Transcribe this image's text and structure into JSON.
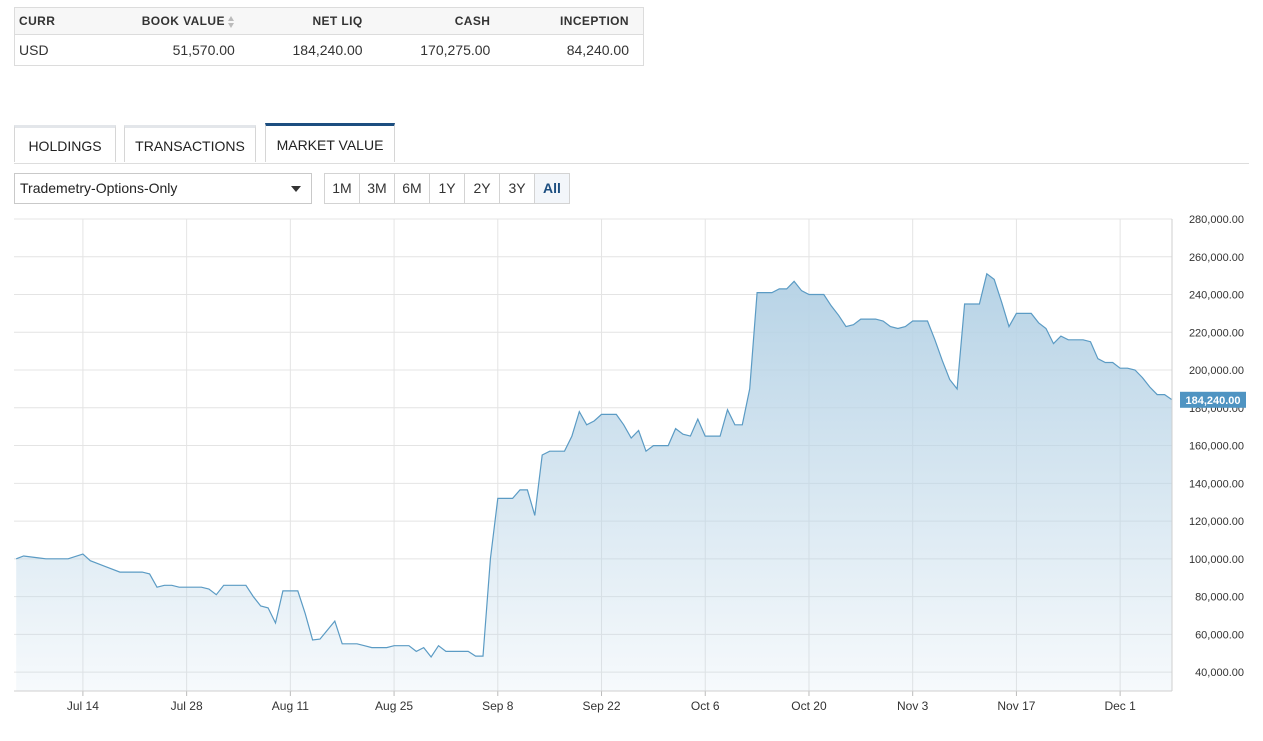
{
  "summary": {
    "headers": {
      "curr": "CURR",
      "book_value": "BOOK VALUE",
      "net_liq": "NET LIQ",
      "cash": "CASH",
      "inception": "INCEPTION"
    },
    "row": {
      "curr": "USD",
      "book_value": "51,570.00",
      "net_liq": "184,240.00",
      "cash": "170,275.00",
      "inception": "84,240.00"
    },
    "inception_color": "#2e7d32"
  },
  "tabs": [
    {
      "label": "HOLDINGS",
      "active": false
    },
    {
      "label": "TRANSACTIONS",
      "active": false
    },
    {
      "label": "MARKET VALUE",
      "active": true
    }
  ],
  "account_select": {
    "value": "Trademetry-Options-Only",
    "icon": "chevron-down-icon"
  },
  "ranges": [
    {
      "label": "1M",
      "active": false
    },
    {
      "label": "3M",
      "active": false
    },
    {
      "label": "6M",
      "active": false
    },
    {
      "label": "1Y",
      "active": false
    },
    {
      "label": "2Y",
      "active": false
    },
    {
      "label": "3Y",
      "active": false
    },
    {
      "label": "All",
      "active": true
    }
  ],
  "accent_color": "#1c4e80",
  "chart_data": {
    "type": "area",
    "title": "",
    "xlabel": "",
    "ylabel": "",
    "ylim": [
      30000,
      280000
    ],
    "y_axis_position": "right",
    "yticks": [
      "40,000.00",
      "60,000.00",
      "80,000.00",
      "100,000.00",
      "120,000.00",
      "140,000.00",
      "160,000.00",
      "180,000.00",
      "200,000.00",
      "220,000.00",
      "240,000.00",
      "260,000.00",
      "280,000.00"
    ],
    "xticks": [
      "Jul 14",
      "Jul 28",
      "Aug 11",
      "Aug 25",
      "Sep 8",
      "Sep 22",
      "Oct 6",
      "Oct 20",
      "Nov 3",
      "Nov 17",
      "Dec 1"
    ],
    "x_start": "Jul 5",
    "x_end": "Dec 4",
    "grid": true,
    "last_value_label": "184,240.00",
    "line_color": "#5b9bc4",
    "fill_color": "#b7d3e6",
    "series": [
      {
        "points": [
          [
            "Jul 5",
            100000
          ],
          [
            "Jul 6",
            101500
          ],
          [
            "Jul 8",
            100500
          ],
          [
            "Jul 9",
            100000
          ],
          [
            "Jul 11",
            100000
          ],
          [
            "Jul 12",
            100000
          ],
          [
            "Jul 14",
            102500
          ],
          [
            "Jul 15",
            99000
          ],
          [
            "Jul 16",
            97500
          ],
          [
            "Jul 17",
            96000
          ],
          [
            "Jul 19",
            93000
          ],
          [
            "Jul 21",
            93000
          ],
          [
            "Jul 22",
            93000
          ],
          [
            "Jul 23",
            92000
          ],
          [
            "Jul 24",
            85000
          ],
          [
            "Jul 25",
            86000
          ],
          [
            "Jul 26",
            86000
          ],
          [
            "Jul 27",
            85000
          ],
          [
            "Jul 28",
            85000
          ],
          [
            "Jul 30",
            85000
          ],
          [
            "Jul 31",
            84000
          ],
          [
            "Aug 1",
            81000
          ],
          [
            "Aug 2",
            86000
          ],
          [
            "Aug 4",
            86000
          ],
          [
            "Aug 5",
            86000
          ],
          [
            "Aug 6",
            80000
          ],
          [
            "Aug 7",
            75000
          ],
          [
            "Aug 8",
            74000
          ],
          [
            "Aug 9",
            66000
          ],
          [
            "Aug 10",
            83000
          ],
          [
            "Aug 12",
            83000
          ],
          [
            "Aug 13",
            71000
          ],
          [
            "Aug 14",
            57000
          ],
          [
            "Aug 15",
            57500
          ],
          [
            "Aug 17",
            67000
          ],
          [
            "Aug 18",
            55000
          ],
          [
            "Aug 20",
            55000
          ],
          [
            "Aug 21",
            54000
          ],
          [
            "Aug 22",
            53000
          ],
          [
            "Aug 24",
            53000
          ],
          [
            "Aug 25",
            54000
          ],
          [
            "Aug 26",
            54000
          ],
          [
            "Aug 27",
            54000
          ],
          [
            "Aug 28",
            51000
          ],
          [
            "Aug 29",
            53000
          ],
          [
            "Aug 30",
            48000
          ],
          [
            "Aug 31",
            54000
          ],
          [
            "Sep 1",
            51000
          ],
          [
            "Sep 3",
            51000
          ],
          [
            "Sep 4",
            51000
          ],
          [
            "Sep 5",
            48500
          ],
          [
            "Sep 6",
            48500
          ],
          [
            "Sep 7",
            100000
          ],
          [
            "Sep 8",
            132000
          ],
          [
            "Sep 9",
            132000
          ],
          [
            "Sep 10",
            132000
          ],
          [
            "Sep 11",
            136500
          ],
          [
            "Sep 12",
            136500
          ],
          [
            "Sep 13",
            123000
          ],
          [
            "Sep 14",
            155000
          ],
          [
            "Sep 15",
            157000
          ],
          [
            "Sep 16",
            157000
          ],
          [
            "Sep 17",
            157000
          ],
          [
            "Sep 18",
            165000
          ],
          [
            "Sep 19",
            178000
          ],
          [
            "Sep 20",
            171000
          ],
          [
            "Sep 21",
            173000
          ],
          [
            "Sep 22",
            176500
          ],
          [
            "Sep 23",
            176500
          ],
          [
            "Sep 24",
            176500
          ],
          [
            "Sep 25",
            171000
          ],
          [
            "Sep 26",
            164000
          ],
          [
            "Sep 27",
            168000
          ],
          [
            "Sep 28",
            157000
          ],
          [
            "Sep 29",
            160000
          ],
          [
            "Sep 30",
            160000
          ],
          [
            "Oct 1",
            160000
          ],
          [
            "Oct 2",
            169000
          ],
          [
            "Oct 3",
            166000
          ],
          [
            "Oct 4",
            165000
          ],
          [
            "Oct 5",
            174000
          ],
          [
            "Oct 6",
            165000
          ],
          [
            "Oct 7",
            165000
          ],
          [
            "Oct 8",
            165000
          ],
          [
            "Oct 9",
            179000
          ],
          [
            "Oct 10",
            171000
          ],
          [
            "Oct 11",
            171000
          ],
          [
            "Oct 12",
            190000
          ],
          [
            "Oct 13",
            241000
          ],
          [
            "Oct 14",
            241000
          ],
          [
            "Oct 15",
            241000
          ],
          [
            "Oct 16",
            243000
          ],
          [
            "Oct 17",
            243000
          ],
          [
            "Oct 18",
            247000
          ],
          [
            "Oct 19",
            242000
          ],
          [
            "Oct 20",
            240000
          ],
          [
            "Oct 21",
            240000
          ],
          [
            "Oct 22",
            240000
          ],
          [
            "Oct 23",
            234000
          ],
          [
            "Oct 24",
            229000
          ],
          [
            "Oct 25",
            223000
          ],
          [
            "Oct 26",
            224000
          ],
          [
            "Oct 27",
            227000
          ],
          [
            "Oct 28",
            227000
          ],
          [
            "Oct 29",
            227000
          ],
          [
            "Oct 30",
            226000
          ],
          [
            "Oct 31",
            223000
          ],
          [
            "Nov 1",
            222000
          ],
          [
            "Nov 2",
            223000
          ],
          [
            "Nov 3",
            226000
          ],
          [
            "Nov 4",
            226000
          ],
          [
            "Nov 5",
            226000
          ],
          [
            "Nov 6",
            216000
          ],
          [
            "Nov 7",
            205000
          ],
          [
            "Nov 8",
            195000
          ],
          [
            "Nov 9",
            190000
          ],
          [
            "Nov 10",
            235000
          ],
          [
            "Nov 11",
            235000
          ],
          [
            "Nov 12",
            235000
          ],
          [
            "Nov 13",
            251000
          ],
          [
            "Nov 14",
            248000
          ],
          [
            "Nov 15",
            236000
          ],
          [
            "Nov 16",
            223000
          ],
          [
            "Nov 17",
            230000
          ],
          [
            "Nov 18",
            230000
          ],
          [
            "Nov 19",
            230000
          ],
          [
            "Nov 20",
            225000
          ],
          [
            "Nov 21",
            222000
          ],
          [
            "Nov 22",
            214000
          ],
          [
            "Nov 23",
            218000
          ],
          [
            "Nov 24",
            216000
          ],
          [
            "Nov 25",
            216000
          ],
          [
            "Nov 26",
            216000
          ],
          [
            "Nov 27",
            215000
          ],
          [
            "Nov 28",
            206000
          ],
          [
            "Nov 29",
            204000
          ],
          [
            "Nov 30",
            204000
          ],
          [
            "Dec 1",
            201000
          ],
          [
            "Dec 2",
            201000
          ],
          [
            "Dec 3",
            200000
          ],
          [
            "Dec 4",
            196000
          ],
          [
            "Dec 5",
            191000
          ],
          [
            "Dec 6",
            187000
          ],
          [
            "Dec 7",
            187000
          ],
          [
            "Dec 8",
            184240
          ]
        ]
      }
    ]
  }
}
